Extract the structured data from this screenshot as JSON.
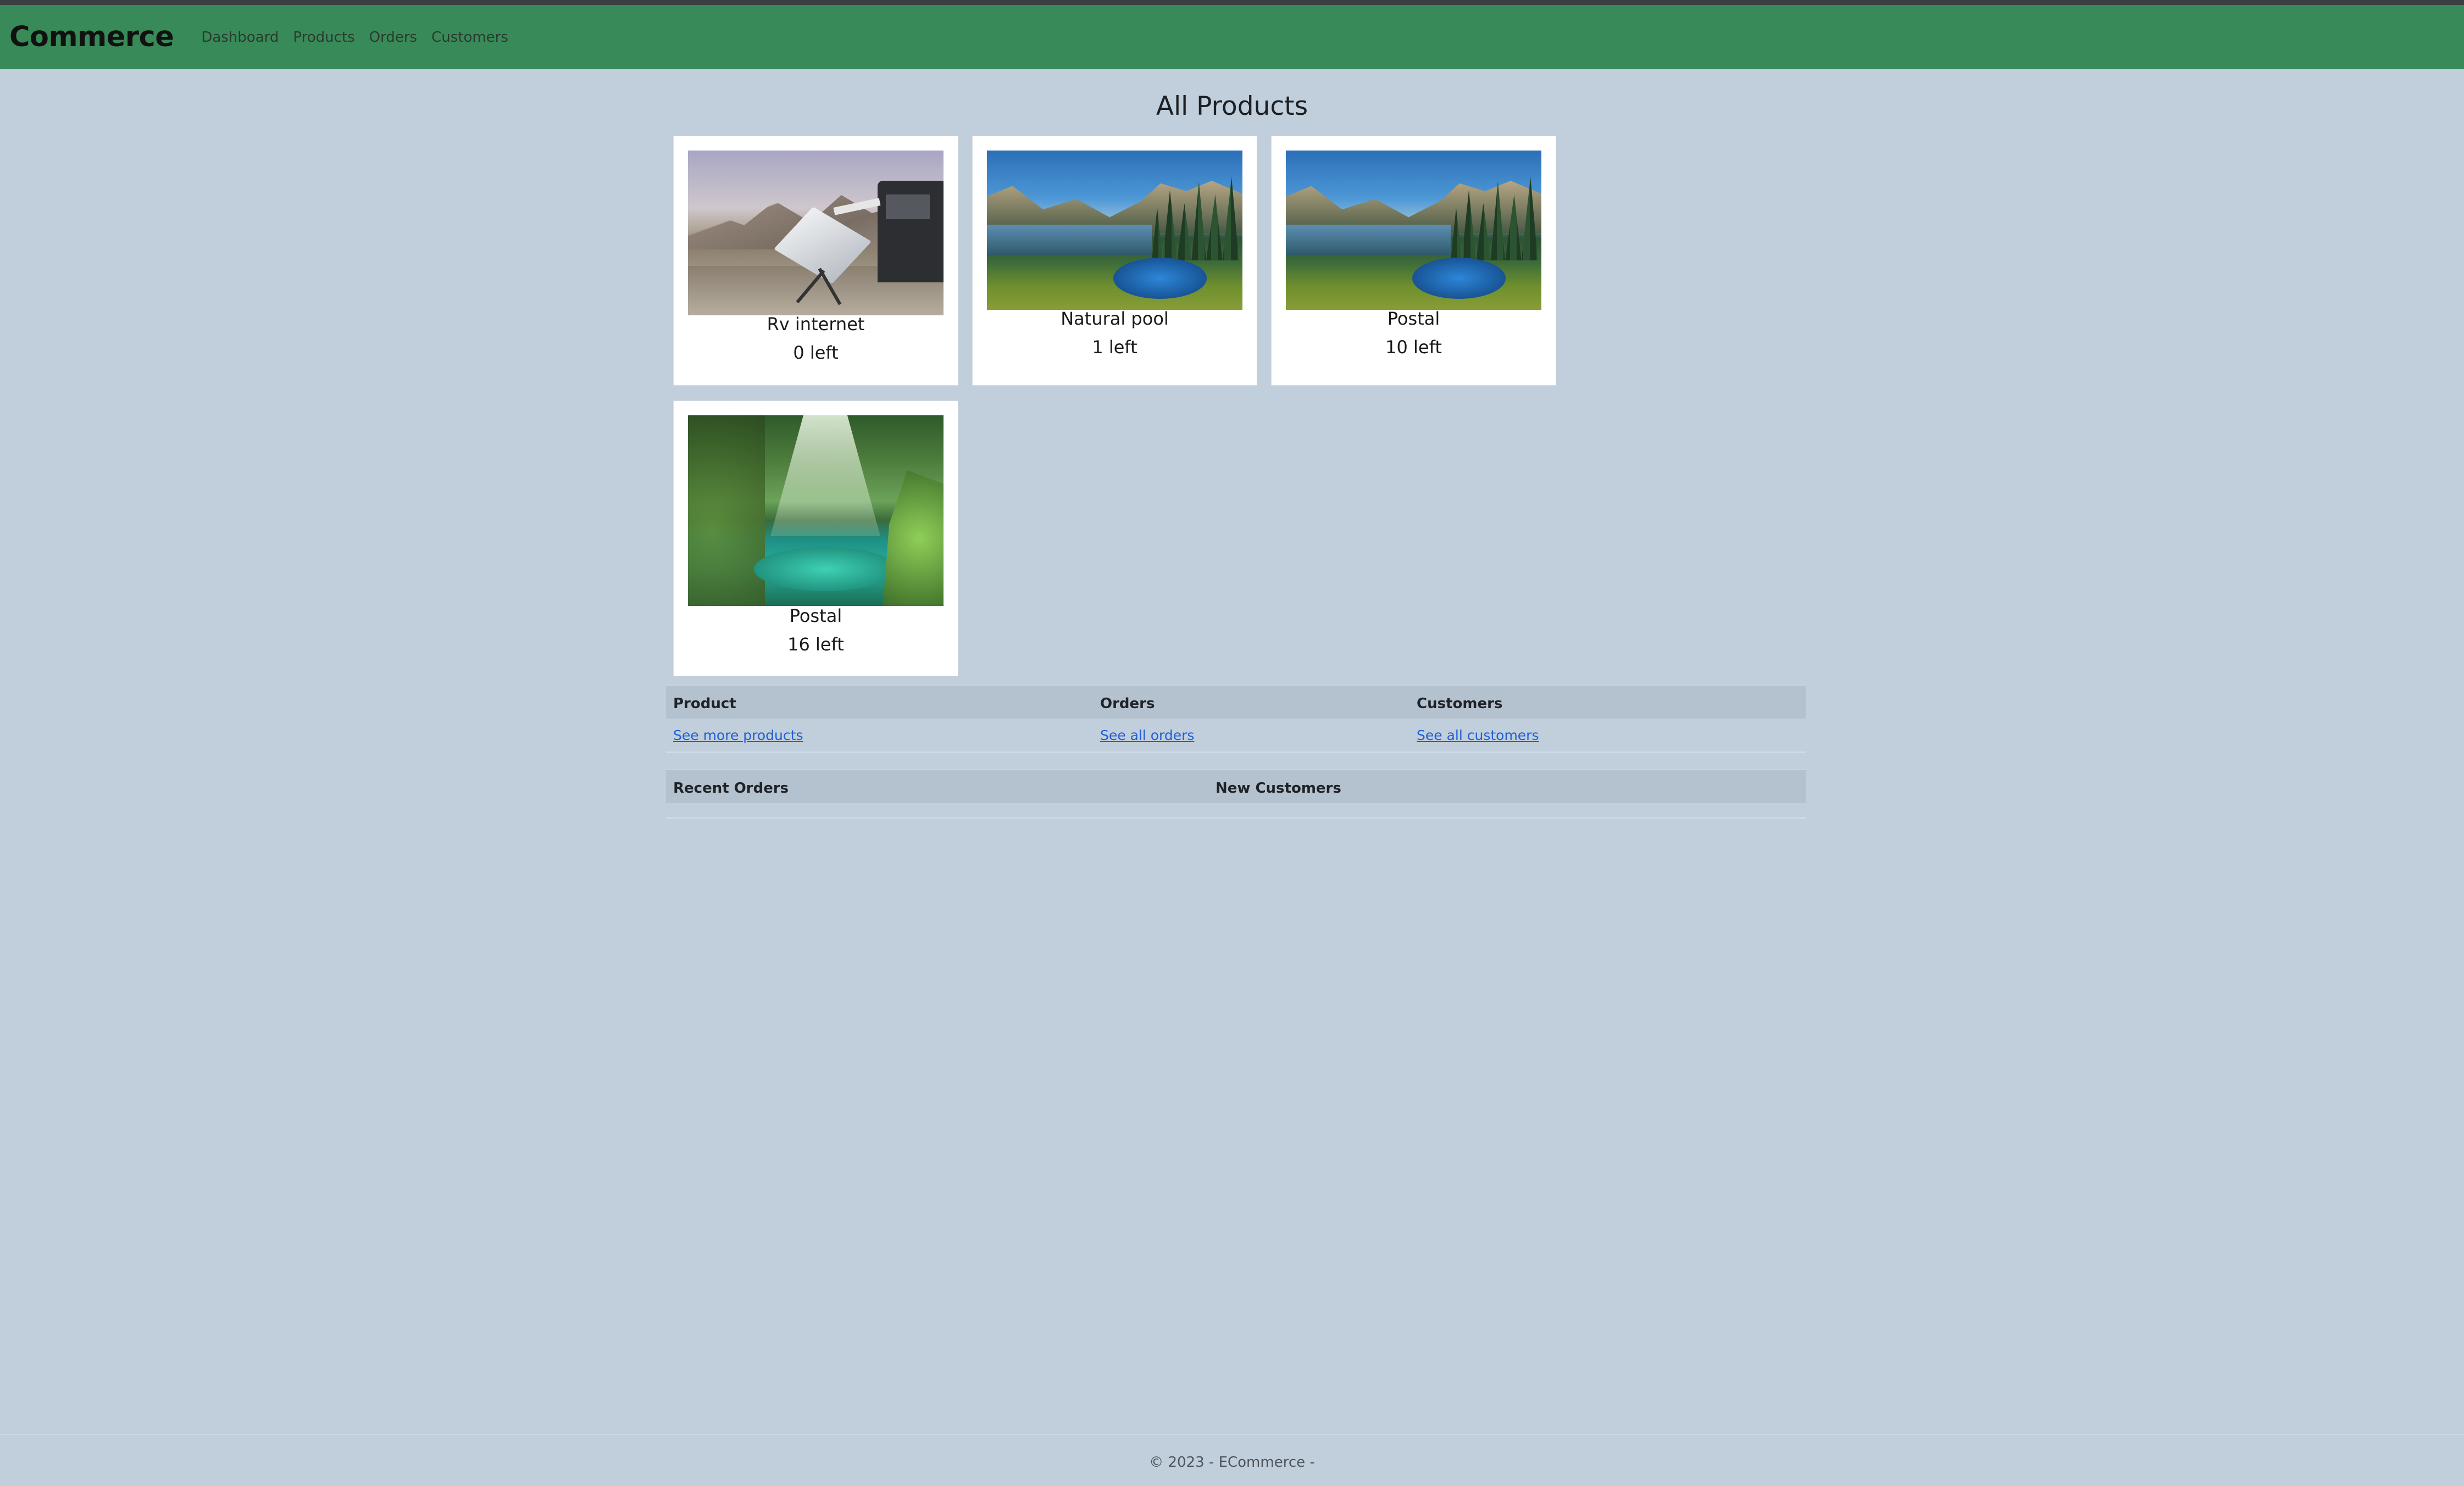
{
  "app": {
    "brand": "Commerce",
    "nav": [
      "Dashboard",
      "Products",
      "Orders",
      "Customers"
    ]
  },
  "page": {
    "title": "All Products"
  },
  "products": [
    {
      "name": "Rv internet",
      "stock": "0 left",
      "image": "rv-satellite-dish-photo"
    },
    {
      "name": "Natural pool",
      "stock": "1 left",
      "image": "mountain-lake-photo"
    },
    {
      "name": "Postal",
      "stock": "10 left",
      "image": "mountain-lake-photo"
    },
    {
      "name": "Postal",
      "stock": "16 left",
      "image": "waterfall-pool-photo"
    }
  ],
  "summary_table": {
    "headers": [
      "Product",
      "Orders",
      "Customers"
    ],
    "links": [
      "See more products",
      "See all orders",
      "See all customers"
    ]
  },
  "recent_table": {
    "headers": [
      "Recent Orders",
      "New Customers"
    ]
  },
  "footer": {
    "text": "© 2023 - ECommerce -"
  }
}
